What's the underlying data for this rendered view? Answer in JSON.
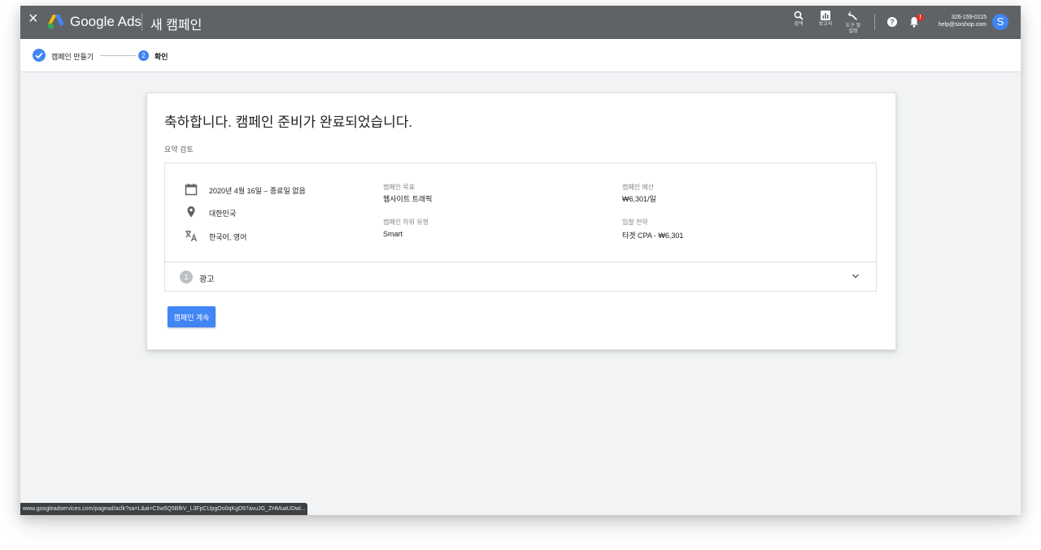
{
  "header": {
    "close_label": "×",
    "brand": "Google Ads",
    "page_title": "새 캠페인",
    "tools": [
      {
        "icon": "search-icon",
        "label": "검색"
      },
      {
        "icon": "reports-icon",
        "label": "보고서"
      },
      {
        "icon": "wrench-icon",
        "label": "도구 및 설정"
      }
    ],
    "notification_badge": "!",
    "account_id": "326-159-0115",
    "account_email": "help@sixshop.com",
    "avatar_letter": "S"
  },
  "stepper": {
    "steps": [
      {
        "label": "캠페인 만들기",
        "state": "done"
      },
      {
        "number": "2",
        "label": "확인",
        "state": "current"
      }
    ]
  },
  "main": {
    "title": "축하합니다. 캠페인 준비가 완료되었습니다.",
    "subtitle": "요약 검토",
    "summary": {
      "date_range": "2020년 4월 16일 – 종료일 없음",
      "location": "대한민국",
      "languages": "한국어, 영어",
      "goal_label": "캠페인 목표",
      "goal_value": "웹사이트 트래픽",
      "subtype_label": "캠페인 하위 유형",
      "subtype_value": "Smart",
      "budget_label": "캠페인 예산",
      "budget_value": "₩6,301/일",
      "bidding_label": "입찰 전략",
      "bidding_value": "타겟 CPA - ₩6,301"
    },
    "ads_section": {
      "number": "1",
      "label": "광고"
    },
    "continue_button": "캠페인 계속"
  },
  "status_bar": {
    "url": "www.googleadservices.com/pagead/aclk?sa=L&ai=C5w5Q5BfkV_L3FpCUpgOo0qKgD97avuJG_ZHMuaUDwl..."
  },
  "colors": {
    "topbar": "#5f6368",
    "accent": "#4285f4",
    "background": "#f1f3f4",
    "notification": "#d93025"
  }
}
